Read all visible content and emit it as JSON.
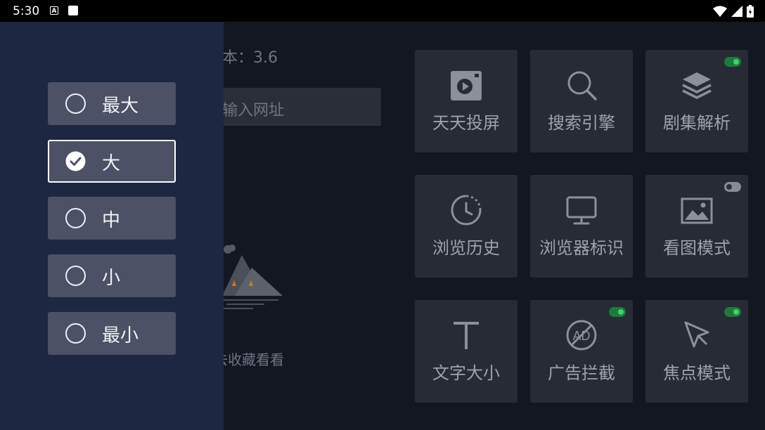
{
  "status_bar": {
    "time": "5:30"
  },
  "background": {
    "version_text": "本：3.6",
    "url_placeholder": "输入网址",
    "empty_text": "去收藏看看"
  },
  "tiles": [
    {
      "label": "天天投屏",
      "icon": "cast-screen-icon",
      "toggle": null
    },
    {
      "label": "搜索引擎",
      "icon": "search-icon",
      "toggle": null
    },
    {
      "label": "剧集解析",
      "icon": "layers-icon",
      "toggle": "on"
    },
    {
      "label": "浏览历史",
      "icon": "history-clock-icon",
      "toggle": null
    },
    {
      "label": "浏览器标识",
      "icon": "monitor-icon",
      "toggle": null
    },
    {
      "label": "看图模式",
      "icon": "image-icon",
      "toggle": "off"
    },
    {
      "label": "文字大小",
      "icon": "text-size-icon",
      "toggle": null
    },
    {
      "label": "广告拦截",
      "icon": "ad-block-icon",
      "toggle": "on"
    },
    {
      "label": "焦点模式",
      "icon": "cursor-icon",
      "toggle": "on"
    }
  ],
  "font_size_options": [
    {
      "label": "最大",
      "selected": false
    },
    {
      "label": "大",
      "selected": true
    },
    {
      "label": "中",
      "selected": false
    },
    {
      "label": "小",
      "selected": false
    },
    {
      "label": "最小",
      "selected": false
    }
  ],
  "colors": {
    "drawer_bg": "#1d2741",
    "option_bg": "#4c5165",
    "toggle_on": "#41d26b",
    "page_bg": "#131722"
  }
}
